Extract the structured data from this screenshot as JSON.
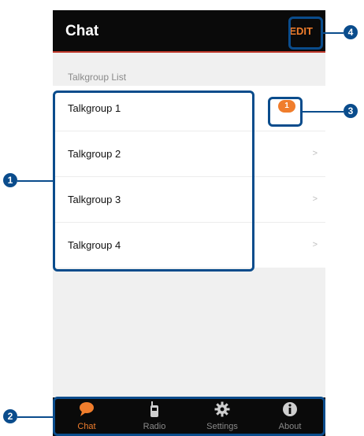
{
  "header": {
    "title": "Chat",
    "edit_label": "EDIT"
  },
  "section_label": "Talkgroup List",
  "talkgroups": [
    {
      "label": "Talkgroup 1",
      "badge": "1"
    },
    {
      "label": "Talkgroup 2",
      "chevron": ">"
    },
    {
      "label": "Talkgroup 3",
      "chevron": ">"
    },
    {
      "label": "Talkgroup 4",
      "chevron": ">"
    }
  ],
  "tabbar": {
    "tabs": [
      {
        "label": "Chat",
        "icon": "chat-bubble-icon",
        "active": true
      },
      {
        "label": "Radio",
        "icon": "radio-icon",
        "active": false
      },
      {
        "label": "Settings",
        "icon": "gear-icon",
        "active": false
      },
      {
        "label": "About",
        "icon": "info-icon",
        "active": false
      }
    ]
  },
  "callouts": [
    "1",
    "2",
    "3",
    "4"
  ],
  "colors": {
    "accent": "#f07d2c",
    "header_bg": "#0a0a0a",
    "callout": "#0a4c8c"
  }
}
